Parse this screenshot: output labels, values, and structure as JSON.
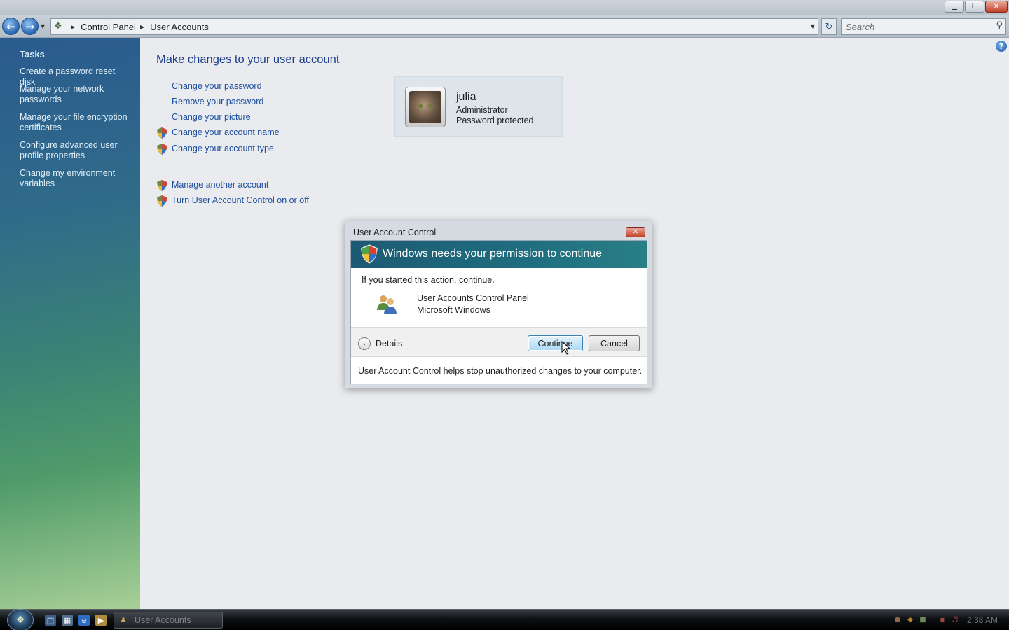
{
  "window": {
    "minimize_glyph": "▁",
    "maximize_glyph": "❐",
    "close_glyph": "✕"
  },
  "navbar": {
    "breadcrumbs": [
      "Control Panel",
      "User Accounts"
    ],
    "search_placeholder": "Search"
  },
  "sidebar": {
    "title": "Tasks",
    "items": [
      {
        "label": "Create a password reset disk"
      },
      {
        "label": "Manage your network passwords"
      },
      {
        "label": "Manage your file encryption certificates"
      },
      {
        "label": "Configure advanced user profile properties"
      },
      {
        "label": "Change my environment variables"
      }
    ]
  },
  "main": {
    "title": "Make changes to your user account",
    "links": [
      {
        "label": "Change your password",
        "shield": false
      },
      {
        "label": "Remove your password",
        "shield": false
      },
      {
        "label": "Change your picture",
        "shield": false
      },
      {
        "label": "Change your account name",
        "shield": true
      },
      {
        "label": "Change your account type",
        "shield": true
      },
      {
        "label": "Manage another account",
        "shield": true
      },
      {
        "label": "Turn User Account Control on or off",
        "shield": true
      }
    ],
    "user": {
      "name": "julia",
      "role": "Administrator",
      "status": "Password protected"
    }
  },
  "uac_dialog": {
    "title": "User Account Control",
    "banner": "Windows needs your permission to continue",
    "instruction": "If you started this action, continue.",
    "program_name": "User Accounts Control Panel",
    "publisher": "Microsoft Windows",
    "details_label": "Details",
    "continue_label": "Continue",
    "cancel_label": "Cancel",
    "footer": "User Account Control helps stop unauthorized changes to your computer.",
    "banner_color": "#1f6e7f"
  },
  "taskbar": {
    "active_task": "User Accounts",
    "clock": "2:38 AM"
  },
  "icons": {
    "back": "back-arrow-icon",
    "forward": "forward-arrow-icon",
    "refresh": "refresh-icon",
    "search": "search-icon",
    "help": "help-icon",
    "shield": "uac-shield-icon",
    "users": "users-icon"
  }
}
